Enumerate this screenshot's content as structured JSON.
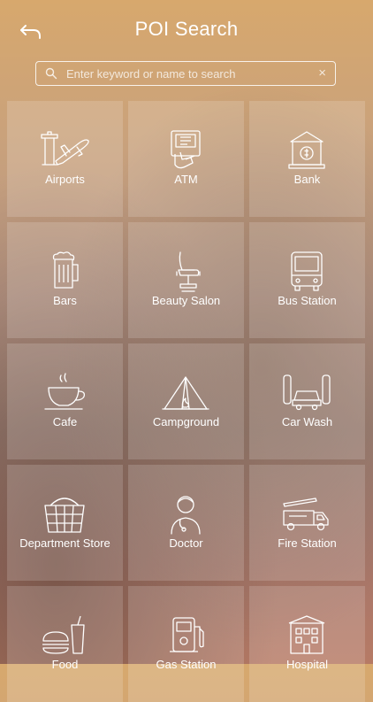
{
  "header": {
    "title": "POI Search",
    "back_icon": "back-arrow-icon"
  },
  "search": {
    "placeholder": "Enter keyword or name to search",
    "value": "",
    "clear_label": "×"
  },
  "categories": [
    {
      "label": "Airports",
      "icon": "airport-icon"
    },
    {
      "label": "ATM",
      "icon": "atm-icon"
    },
    {
      "label": "Bank",
      "icon": "bank-icon"
    },
    {
      "label": "Bars",
      "icon": "beer-mug-icon"
    },
    {
      "label": "Beauty Salon",
      "icon": "salon-chair-icon"
    },
    {
      "label": "Bus Station",
      "icon": "bus-icon"
    },
    {
      "label": "Cafe",
      "icon": "coffee-cup-icon"
    },
    {
      "label": "Campground",
      "icon": "tent-icon"
    },
    {
      "label": "Car Wash",
      "icon": "car-wash-icon"
    },
    {
      "label": "Department Store",
      "icon": "shopping-basket-icon"
    },
    {
      "label": "Doctor",
      "icon": "doctor-icon"
    },
    {
      "label": "Fire Station",
      "icon": "fire-truck-icon"
    },
    {
      "label": "Food",
      "icon": "food-icon"
    },
    {
      "label": "Gas Station",
      "icon": "gas-pump-icon"
    },
    {
      "label": "Hospital",
      "icon": "hospital-icon"
    }
  ]
}
